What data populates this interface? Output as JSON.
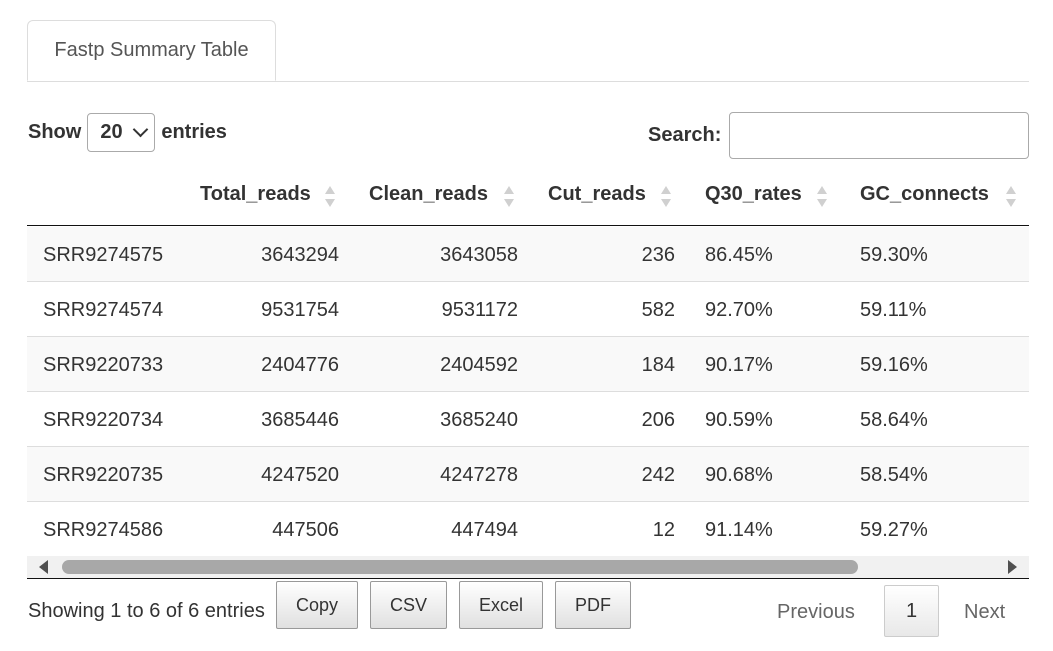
{
  "tab": {
    "label": "Fastp Summary Table"
  },
  "length_menu": {
    "show_label": "Show",
    "selected": "20",
    "entries_label": "entries"
  },
  "search": {
    "label": "Search:",
    "value": ""
  },
  "table": {
    "columns": [
      "",
      "Total_reads",
      "Clean_reads",
      "Cut_reads",
      "Q30_rates",
      "GC_connects"
    ],
    "rows": [
      [
        "SRR9274575",
        "3643294",
        "3643058",
        "236",
        "86.45%",
        "59.30%"
      ],
      [
        "SRR9274574",
        "9531754",
        "9531172",
        "582",
        "92.70%",
        "59.11%"
      ],
      [
        "SRR9220733",
        "2404776",
        "2404592",
        "184",
        "90.17%",
        "59.16%"
      ],
      [
        "SRR9220734",
        "3685446",
        "3685240",
        "206",
        "90.59%",
        "58.64%"
      ],
      [
        "SRR9220735",
        "4247520",
        "4247278",
        "242",
        "90.68%",
        "58.54%"
      ],
      [
        "SRR9274586",
        "447506",
        "447494",
        "12",
        "91.14%",
        "59.27%"
      ]
    ]
  },
  "info": "Showing 1 to 6 of 6 entries",
  "buttons": {
    "copy": "Copy",
    "csv": "CSV",
    "excel": "Excel",
    "pdf": "PDF"
  },
  "pagination": {
    "previous": "Previous",
    "current": "1",
    "next": "Next"
  }
}
